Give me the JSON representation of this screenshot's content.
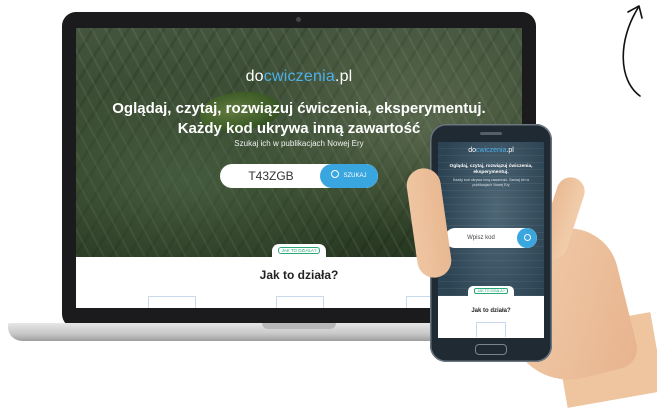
{
  "site": {
    "logo_prefix": "do",
    "logo_accent": "cwiczenia",
    "logo_suffix": ".pl",
    "headline_1": "Oglądaj, czytaj, rozwiązuj ćwiczenia, eksperymentuj.",
    "headline_2": "Każdy kod ukrywa inną zawartość",
    "subtext": "Szukaj ich w publikacjach Nowej Ery",
    "search_value": "T43ZGB",
    "search_button": "SZUKAJ",
    "how_tab": "JAK TO DZIAŁA?",
    "how_heading": "Jak to działa?"
  },
  "phone": {
    "logo_prefix": "do",
    "logo_accent": "cwiczenia",
    "logo_suffix": ".pl",
    "headline": "Oglądaj, czytaj, rozwiązuj ćwiczenia, eksperymentuj.",
    "subtext": "Każdy kod ukrywa inną zawartość. Szukaj ich w publikacjach Nowej Ery",
    "search_placeholder": "Wpisz kod",
    "how_tab": "JAK TO DZIAŁA?",
    "how_heading": "Jak to działa?"
  },
  "colors": {
    "accent": "#3aa6e0",
    "tab_green": "#2aa87a",
    "device_frame": "#1b1b1d"
  },
  "icons": [
    "search-icon",
    "arrow-icon"
  ]
}
